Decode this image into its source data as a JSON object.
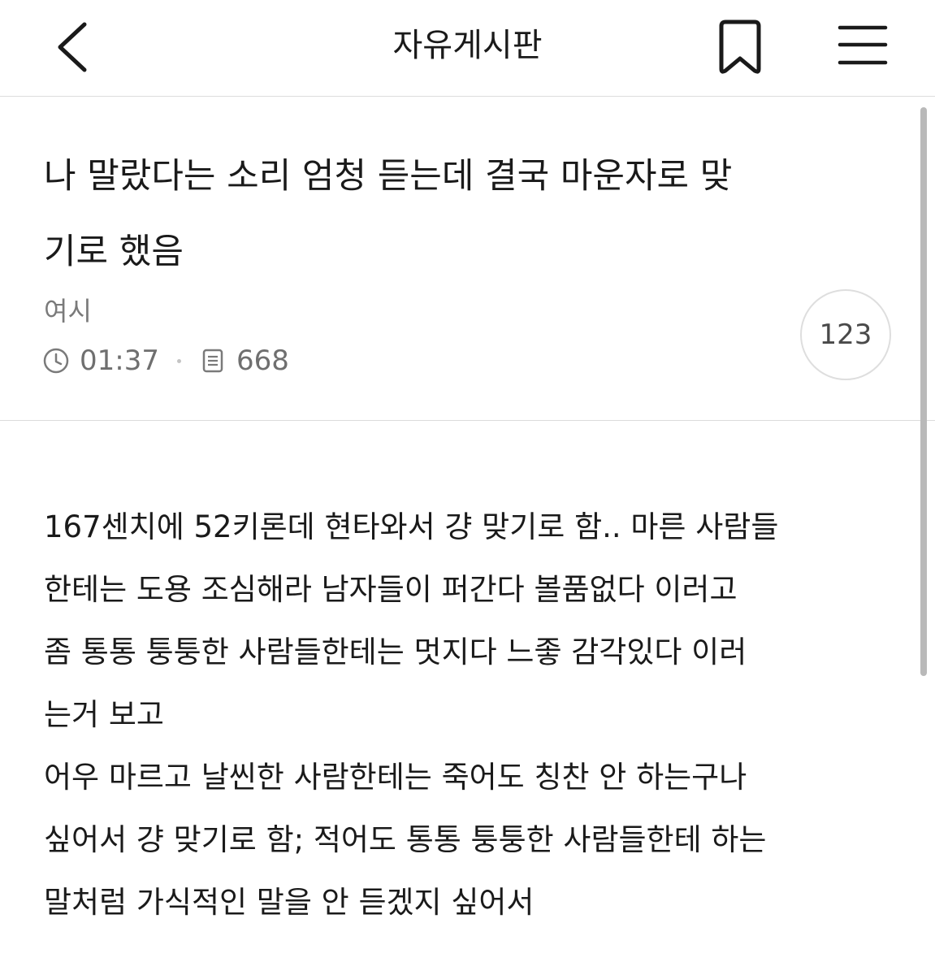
{
  "header": {
    "board_title": "자유게시판"
  },
  "post": {
    "title": "나 말랐다는 소리 엄청 듣는데 결국 마운자로 맞기로 했음",
    "title_lines": [
      "나 말랐다는 소리 엄청 듣는데 결국 마운자로 맞",
      "기로 했음"
    ],
    "author": "여시",
    "time": "01:37",
    "views": "668",
    "comment_count": "123",
    "body_lines": [
      "167센치에 52키론데 현타와서 걍 맞기로 함.. 마른 사람들",
      "한테는 도용 조심해라 남자들이 퍼간다 볼품없다 이러고",
      "좀 통통 퉁퉁한 사람들한테는 멋지다 느좋 감각있다 이러",
      "는거 보고",
      "어우 마르고 날씬한 사람한테는 죽어도 칭찬 안 하는구나",
      "싶어서 걍 맞기로 함; 적어도 통통 퉁퉁한 사람들한테 하는",
      "말처럼 가식적인 말을 안 듣겠지 싶어서"
    ]
  },
  "icons": {
    "back": "chevron-left-icon",
    "bookmark": "bookmark-icon",
    "menu": "hamburger-menu-icon",
    "time": "clock-icon",
    "views": "document-icon"
  }
}
